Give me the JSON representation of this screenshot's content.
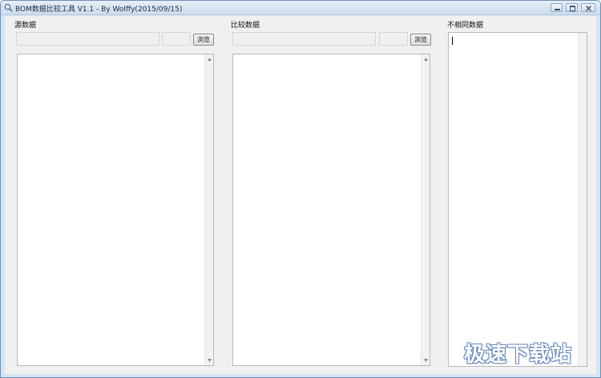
{
  "window": {
    "title": "BOM数据比较工具 V1.1 - By Wolffy(2015/09/15)",
    "accent_color": "#d7e4f2"
  },
  "titlebar_buttons": {
    "minimize_icon": "minimize-icon",
    "maximize_icon": "maximize-icon",
    "close_icon": "close-icon"
  },
  "panels": {
    "source": {
      "label": "源数据",
      "path_value": "",
      "extra_value": "",
      "browse_label": "浏览",
      "list_items": []
    },
    "compare": {
      "label": "比较数据",
      "path_value": "",
      "extra_value": "",
      "browse_label": "浏览",
      "list_items": []
    },
    "diff": {
      "label": "不相同数据",
      "content": ""
    }
  },
  "watermark": {
    "text": "极速下载站"
  }
}
